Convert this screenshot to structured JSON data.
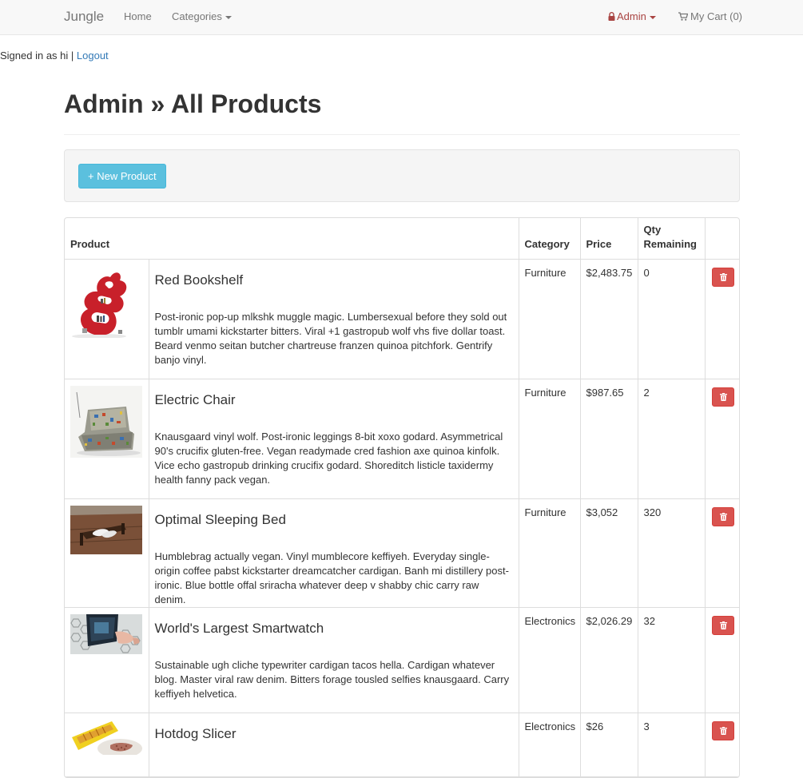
{
  "navbar": {
    "brand": "Jungle",
    "home": "Home",
    "categories": "Categories",
    "admin": "Admin",
    "cart": "My Cart (0)"
  },
  "session": {
    "signed_in_text": "Signed in as hi |",
    "logout": "Logout"
  },
  "page": {
    "title": "Admin » All Products",
    "new_product_button": "+ New Product"
  },
  "table": {
    "headers": {
      "product": "Product",
      "category": "Category",
      "price": "Price",
      "qty": "Qty Remaining"
    },
    "rows": [
      {
        "name": "Red Bookshelf",
        "description": "Post-ironic pop-up mlkshk muggle magic. Lumbersexual before they sold out tumblr umami kickstarter bitters. Viral +1 gastropub wolf vhs five dollar toast. Beard venmo seitan butcher chartreuse franzen quinoa pitchfork. Gentrify banjo vinyl.",
        "category": "Furniture",
        "price": "$2,483.75",
        "qty": "0"
      },
      {
        "name": "Electric Chair",
        "description": "Knausgaard vinyl wolf. Post-ironic leggings 8-bit xoxo godard. Asymmetrical 90's crucifix gluten-free. Vegan readymade cred fashion axe quinoa kinfolk. Vice echo gastropub drinking crucifix godard. Shoreditch listicle taxidermy health fanny pack vegan.",
        "category": "Furniture",
        "price": "$987.65",
        "qty": "2"
      },
      {
        "name": "Optimal Sleeping Bed",
        "description": "Humblebrag actually vegan. Vinyl mumblecore keffiyeh. Everyday single-origin coffee pabst kickstarter dreamcatcher cardigan. Banh mi distillery post-ironic. Blue bottle offal sriracha whatever deep v shabby chic carry raw denim.",
        "category": "Furniture",
        "price": "$3,052",
        "qty": "320"
      },
      {
        "name": "World's Largest Smartwatch",
        "description": "Sustainable ugh cliche typewriter cardigan tacos hella. Cardigan whatever blog. Master viral raw denim. Bitters forage tousled selfies knausgaard. Carry keffiyeh helvetica.",
        "category": "Electronics",
        "price": "$2,026.29",
        "qty": "32"
      },
      {
        "name": "Hotdog Slicer",
        "description": "",
        "category": "Electronics",
        "price": "$26",
        "qty": "3"
      }
    ]
  },
  "colors": {
    "navbar_bg": "#f8f8f8",
    "admin_link": "#a94442",
    "info_button": "#5bc0de",
    "danger_button": "#d9534f",
    "link": "#337ab7"
  }
}
